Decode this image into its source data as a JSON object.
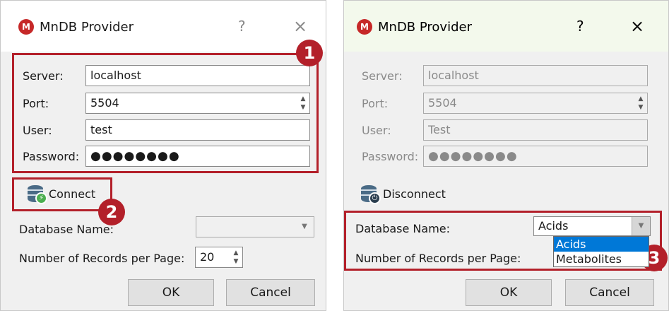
{
  "left_dialog": {
    "title": "MnDB Provider",
    "help": "?",
    "close": "×",
    "server_label": "Server:",
    "server_value": "localhost",
    "port_label": "Port:",
    "port_value": "5504",
    "user_label": "User:",
    "user_value": "test",
    "password_label": "Password:",
    "password_value": "●●●●●●●●",
    "connect_label": "Connect",
    "database_label": "Database Name:",
    "database_value": "",
    "records_label": "Number of Records per Page:",
    "records_value": "20",
    "ok_label": "OK",
    "cancel_label": "Cancel"
  },
  "right_dialog": {
    "title": "MnDB Provider",
    "help": "?",
    "close": "×",
    "server_label": "Server:",
    "server_value": "localhost",
    "port_label": "Port:",
    "port_value": "5504",
    "user_label": "User:",
    "user_value": "Test",
    "password_label": "Password:",
    "password_value": "●●●●●●●●",
    "disconnect_label": "Disconnect",
    "database_label": "Database Name:",
    "database_value": "Acids",
    "database_options": [
      "Acids",
      "Metabolites"
    ],
    "records_label": "Number of Records per Page:",
    "ok_label": "OK",
    "cancel_label": "Cancel"
  },
  "markers": [
    "1",
    "2",
    "3"
  ],
  "colors": {
    "highlight": "#b3202a",
    "selection": "#0078d7",
    "logo": "#c62828"
  },
  "icons": {
    "logo": "mndb-logo-icon",
    "connect": "database-connect-icon",
    "disconnect": "database-disconnect-icon"
  }
}
